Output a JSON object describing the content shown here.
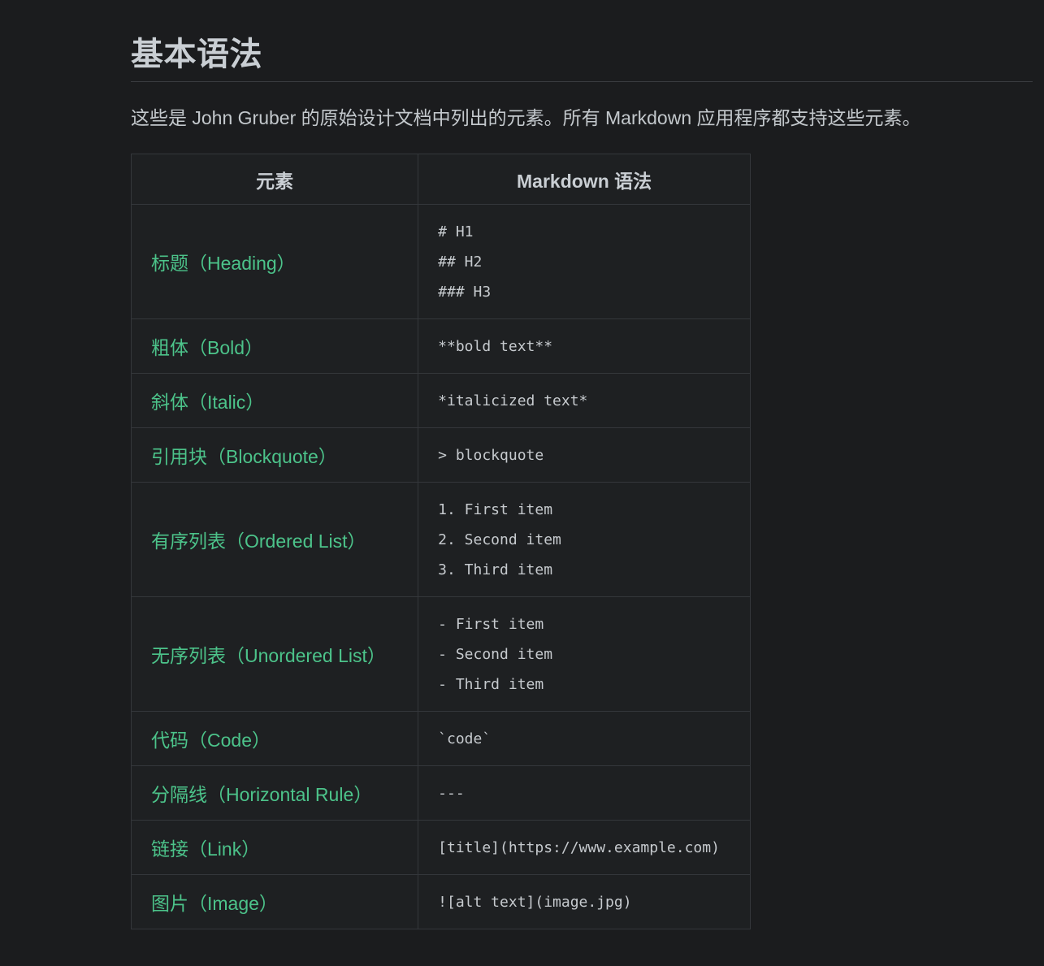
{
  "heading": "基本语法",
  "intro": "这些是 John Gruber 的原始设计文档中列出的元素。所有 Markdown 应用程序都支持这些元素。",
  "table": {
    "headers": [
      "元素",
      "Markdown 语法"
    ],
    "rows": [
      {
        "element": "标题（Heading）",
        "syntax": [
          "# H1",
          "## H2",
          "### H3"
        ]
      },
      {
        "element": "粗体（Bold）",
        "syntax": [
          "**bold text**"
        ]
      },
      {
        "element": "斜体（Italic）",
        "syntax": [
          "*italicized text*"
        ]
      },
      {
        "element": "引用块（Blockquote）",
        "syntax": [
          "> blockquote"
        ]
      },
      {
        "element": "有序列表（Ordered List）",
        "syntax": [
          "1. First item",
          "2. Second item",
          "3. Third item"
        ]
      },
      {
        "element": "无序列表（Unordered List）",
        "syntax": [
          "- First item",
          "- Second item",
          "- Third item"
        ]
      },
      {
        "element": "代码（Code）",
        "syntax": [
          "`code`"
        ]
      },
      {
        "element": "分隔线（Horizontal Rule）",
        "syntax": [
          "---"
        ]
      },
      {
        "element": "链接（Link）",
        "syntax": [
          "[title](https://www.example.com)"
        ]
      },
      {
        "element": "图片（Image）",
        "syntax": [
          "![alt text](image.jpg)"
        ]
      }
    ]
  },
  "colors": {
    "background": "#1b1c1e",
    "element_text": "#4cc38a",
    "heading_text": "#c9ced3"
  }
}
